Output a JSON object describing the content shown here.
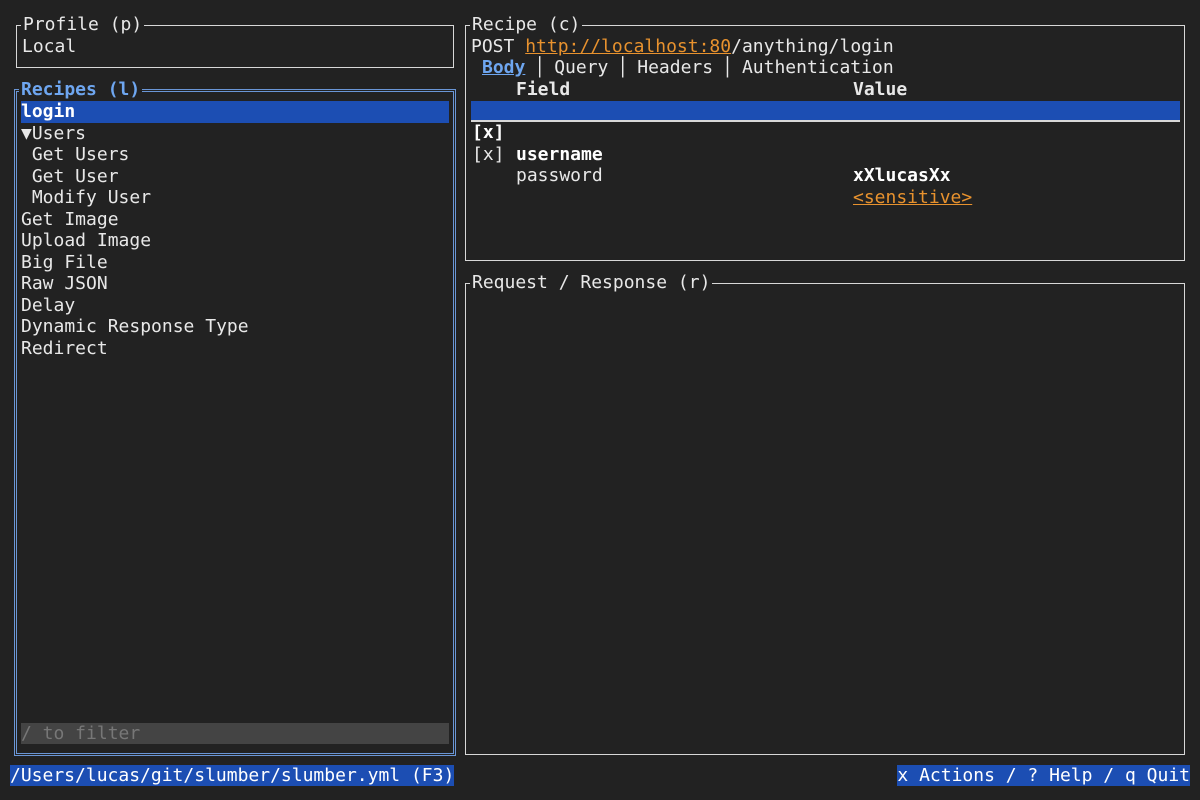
{
  "profile": {
    "title": "Profile (p)",
    "value": "Local"
  },
  "recipes": {
    "title": "Recipes (l)",
    "items": [
      {
        "label": "login",
        "selected": true
      },
      {
        "label": "▼Users"
      },
      {
        "label": " Get Users"
      },
      {
        "label": " Get User"
      },
      {
        "label": " Modify User"
      },
      {
        "label": "Get Image"
      },
      {
        "label": "Upload Image"
      },
      {
        "label": "Big File"
      },
      {
        "label": "Raw JSON"
      },
      {
        "label": "Delay"
      },
      {
        "label": "Dynamic Response Type"
      },
      {
        "label": "Redirect"
      }
    ],
    "filter_placeholder": "/ to filter"
  },
  "recipe": {
    "title": "Recipe (c)",
    "method": "POST",
    "url_host": "http://localhost:80",
    "url_path": "/anything/login",
    "tabs": [
      "Body",
      "Query",
      "Headers",
      "Authentication"
    ],
    "active_tab": "Body",
    "table": {
      "headers": {
        "field": "Field",
        "value": "Value"
      },
      "rows": [
        {
          "check": "[x]",
          "field": "username",
          "value": "xXlucasXx",
          "selected": true
        },
        {
          "check": "[x]",
          "field": "password",
          "value": "<sensitive>",
          "sensitive": true
        }
      ]
    }
  },
  "response": {
    "title": "Request / Response (r)"
  },
  "footer": {
    "path": "/Users/lucas/git/slumber/slumber.yml (F3)",
    "help": "x Actions / ? Help / q Quit"
  },
  "colors": {
    "background": "#222222",
    "selection": "#1c4eb3",
    "focus_accent": "#6ea6f0",
    "link": "#e8922e"
  }
}
